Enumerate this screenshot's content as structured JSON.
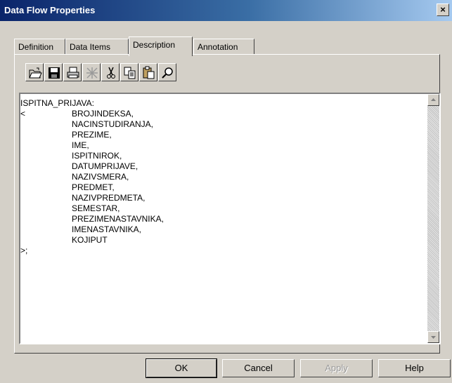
{
  "window": {
    "title": "Data Flow Properties",
    "close_glyph": "×"
  },
  "tabs": [
    {
      "label": "Definition"
    },
    {
      "label": "Data Items"
    },
    {
      "label": "Description",
      "active": true
    },
    {
      "label": "Annotation"
    }
  ],
  "toolbar": {
    "buttons": [
      {
        "icon": "open-folder-icon"
      },
      {
        "icon": "save-icon"
      },
      {
        "icon": "print-icon"
      },
      {
        "icon": "clear-icon",
        "disabled": true
      },
      {
        "icon": "cut-icon"
      },
      {
        "icon": "copy-icon"
      },
      {
        "icon": "paste-icon"
      },
      {
        "icon": "find-icon"
      }
    ]
  },
  "description": {
    "lines": [
      {
        "prefix": "ISPITNA_PRIJAVA:",
        "item": ""
      },
      {
        "prefix": "<",
        "item": "BROJINDEKSA,"
      },
      {
        "prefix": "",
        "item": "NACINSTUDIRANJA,"
      },
      {
        "prefix": "",
        "item": "PREZIME,"
      },
      {
        "prefix": "",
        "item": "IME,"
      },
      {
        "prefix": "",
        "item": "ISPITNIROK,"
      },
      {
        "prefix": "",
        "item": "DATUMPRIJAVE,"
      },
      {
        "prefix": "",
        "item": "NAZIVSMERA,"
      },
      {
        "prefix": "",
        "item": "PREDMET,"
      },
      {
        "prefix": "",
        "item": "NAZIVPREDMETA,"
      },
      {
        "prefix": "",
        "item": "SEMESTAR,"
      },
      {
        "prefix": "",
        "item": "PREZIMENASTAVNIKA,"
      },
      {
        "prefix": "",
        "item": "IMENASTAVNIKA,"
      },
      {
        "prefix": "",
        "item": "KOJIPUT"
      },
      {
        "prefix": ">;",
        "item": ""
      }
    ]
  },
  "buttons": {
    "ok": "OK",
    "cancel": "Cancel",
    "apply": "Apply",
    "help": "Help"
  }
}
